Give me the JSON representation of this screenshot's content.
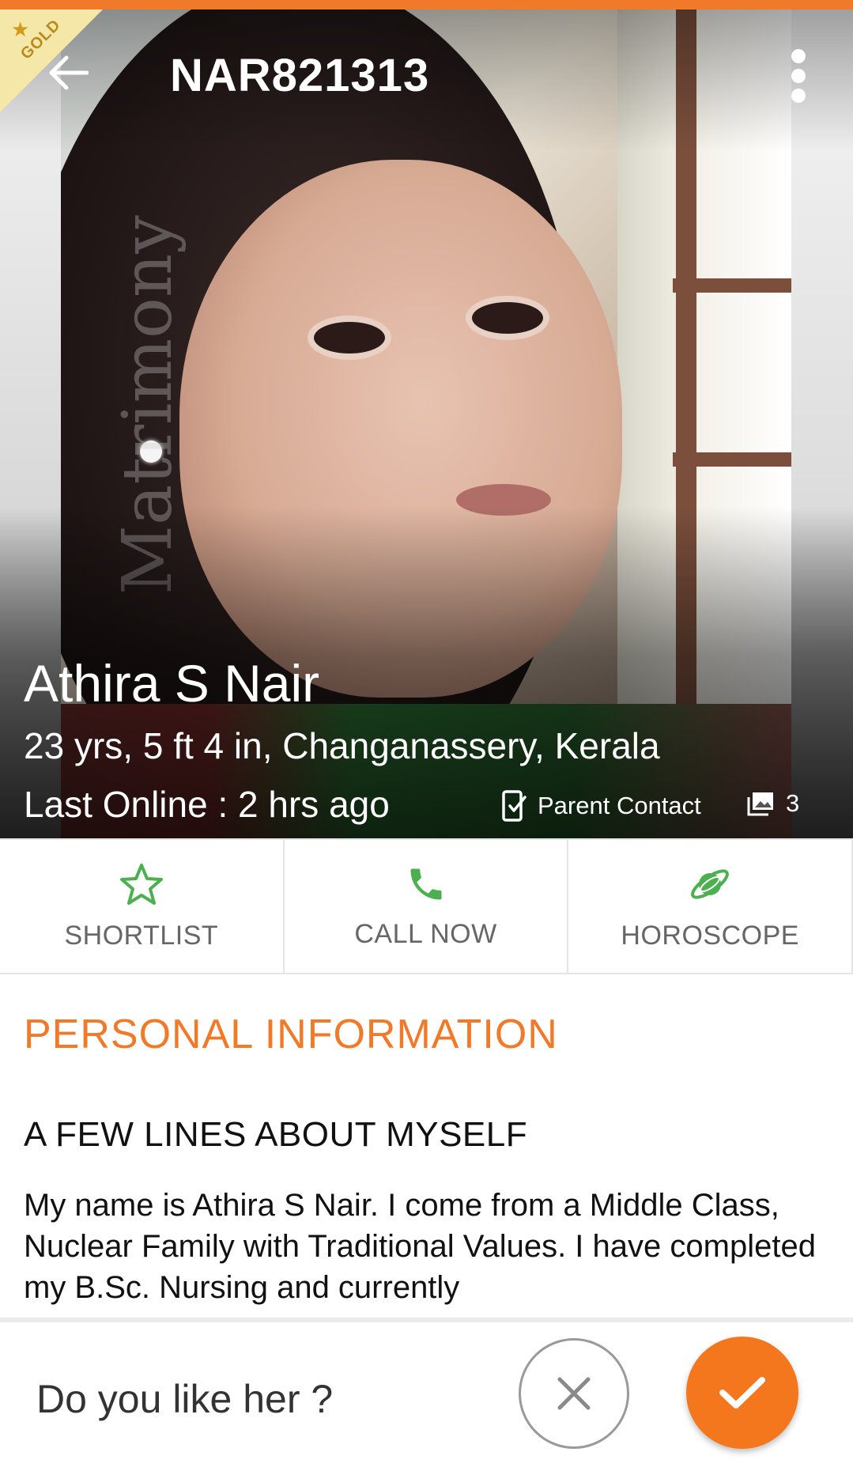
{
  "header": {
    "badge": "GOLD",
    "profile_id": "NAR821313"
  },
  "photo": {
    "watermark": "Matrimony"
  },
  "profile": {
    "name": "Athira S Nair",
    "details": "23 yrs, 5 ft 4 in, Changanassery, Kerala",
    "last_online": "Last Online : 2 hrs  ago",
    "parent_contact_label": "Parent Contact",
    "photo_count": "3"
  },
  "actions": [
    {
      "label": "SHORTLIST",
      "icon": "star-outline-icon"
    },
    {
      "label": "CALL NOW",
      "icon": "phone-icon"
    },
    {
      "label": "HOROSCOPE",
      "icon": "planet-icon"
    }
  ],
  "personal_info": {
    "section_title": "PERSONAL INFORMATION",
    "about_title": "A FEW LINES ABOUT MYSELF",
    "about_text": "My name is Athira S Nair. I come from a Middle Class, Nuclear Family with Traditional Values. I have completed my B.Sc. Nursing and currently"
  },
  "bottom": {
    "question": "Do you like her ?"
  },
  "colors": {
    "accent": "#f07a2a",
    "action_icon": "#4caf50",
    "gold_badge": "#f4e7a8"
  }
}
